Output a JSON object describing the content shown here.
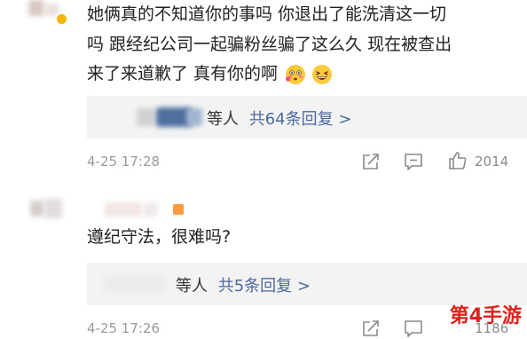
{
  "comments": [
    {
      "text_lines": [
        "她俩真的不知道你的事吗 你退出了能洗清这一切",
        "吗 跟经纪公司一起骗粉丝骗了这么久 现在被查出",
        "来了来道歉了 真有你的啊"
      ],
      "emoji": [
        "flushed-face-emoji",
        "laughing-face-emoji"
      ],
      "reply_suffix": "等人",
      "reply_link": "共64条回复 >",
      "date": "4-25 17:28",
      "like_count": "2014"
    },
    {
      "text_lines": [
        "遵纪守法，很难吗?"
      ],
      "reply_suffix": "等人",
      "reply_link": "共5条回复 >",
      "date": "4-25 17:26",
      "like_count": "1186"
    }
  ],
  "watermark": "第4手游",
  "colors": {
    "link": "#4a6a9e",
    "meta": "#9a9a9a",
    "watermark": "#e0201a",
    "reply_bg": "#f3f3f3"
  }
}
